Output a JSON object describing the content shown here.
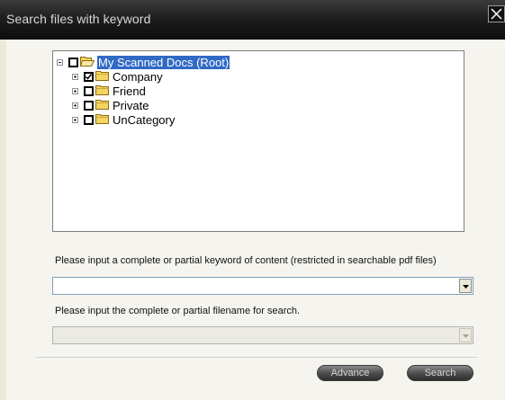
{
  "window": {
    "title": "Search files with keyword",
    "close_label": "close"
  },
  "tree": {
    "root": {
      "label": "My Scanned Docs (Root)",
      "checked": false,
      "selected": true
    },
    "children": [
      {
        "label": "Company",
        "checked": true
      },
      {
        "label": "Friend",
        "checked": false
      },
      {
        "label": "Private",
        "checked": false
      },
      {
        "label": "UnCategory",
        "checked": false
      }
    ]
  },
  "keyword": {
    "prompt": "Please input a complete or partial keyword of content (restricted in searchable pdf files)",
    "value": ""
  },
  "filename": {
    "prompt": "Please input the complete or partial filename for search.",
    "value": "",
    "disabled": true
  },
  "buttons": {
    "advance": "Advance",
    "search": "Search"
  },
  "icons": {
    "close": "close-icon",
    "folder": "folder-icon",
    "open_folder": "open-folder-icon",
    "expand": "plus-expander-icon",
    "collapse": "minus-expander-icon",
    "dropdown": "dropdown-arrow-icon"
  },
  "colors": {
    "title_bar": "#111111",
    "selection": "#316ac5",
    "folder": "#f5d562"
  }
}
